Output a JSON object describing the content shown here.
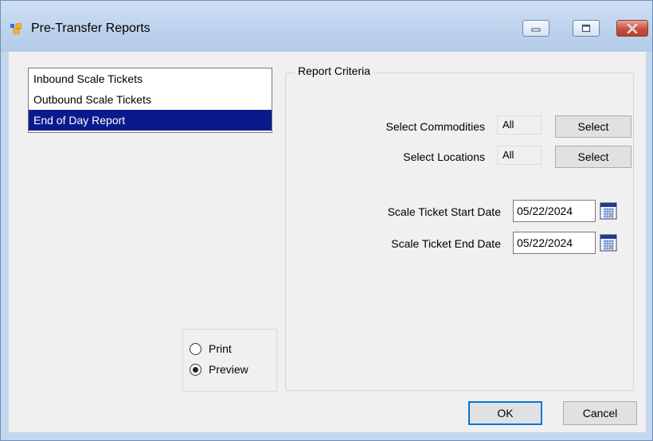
{
  "window": {
    "title": "Pre-Transfer Reports",
    "icon": "app-icon",
    "controls": [
      "minimize-icon",
      "restore-icon",
      "close-icon"
    ]
  },
  "report_list": {
    "items": [
      {
        "label": "Inbound Scale Tickets",
        "selected": false
      },
      {
        "label": "Outbound Scale Tickets",
        "selected": false
      },
      {
        "label": "End of Day Report",
        "selected": true
      }
    ]
  },
  "output": {
    "options": [
      {
        "label": "Print",
        "checked": false
      },
      {
        "label": "Preview",
        "checked": true
      }
    ]
  },
  "criteria": {
    "group_title": "Report Criteria",
    "commodities": {
      "label": "Select Commodities",
      "value": "All",
      "button": "Select"
    },
    "locations": {
      "label": "Select Locations",
      "value": "All",
      "button": "Select"
    },
    "start_date": {
      "label": "Scale Ticket Start Date",
      "value": "05/22/2024",
      "icon": "calendar-icon"
    },
    "end_date": {
      "label": "Scale Ticket End Date",
      "value": "05/22/2024",
      "icon": "calendar-icon"
    }
  },
  "footer": {
    "ok": "OK",
    "cancel": "Cancel"
  },
  "colors": {
    "selection": "#0a1a8c",
    "titlebar": "#c4d7ef",
    "close_button": "#c9503d",
    "default_button_border": "#0078d7"
  }
}
